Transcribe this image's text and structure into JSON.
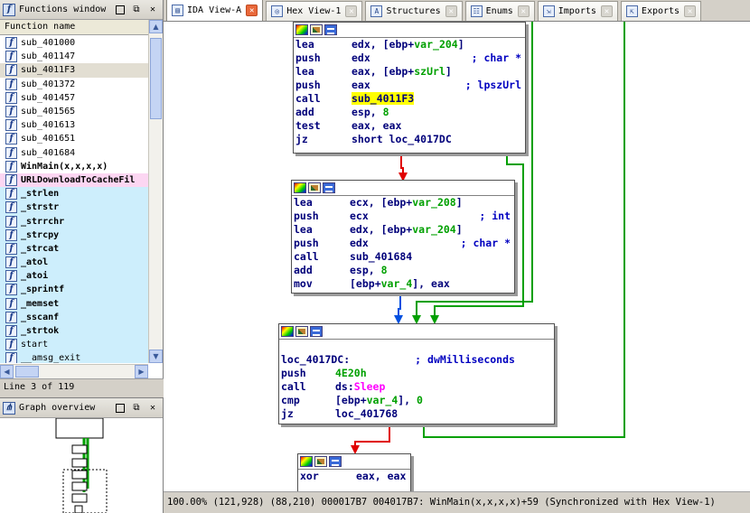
{
  "functions_window": {
    "title": "Functions window",
    "column_header": "Function name",
    "items": [
      {
        "name": "sub_401000",
        "kind": "normal"
      },
      {
        "name": "sub_401147",
        "kind": "normal"
      },
      {
        "name": "sub_4011F3",
        "kind": "selected"
      },
      {
        "name": "sub_401372",
        "kind": "normal"
      },
      {
        "name": "sub_401457",
        "kind": "normal"
      },
      {
        "name": "sub_401565",
        "kind": "normal"
      },
      {
        "name": "sub_401613",
        "kind": "normal"
      },
      {
        "name": "sub_401651",
        "kind": "normal"
      },
      {
        "name": "sub_401684",
        "kind": "normal"
      },
      {
        "name": "WinMain(x,x,x,x)",
        "kind": "bold"
      },
      {
        "name": "URLDownloadToCacheFil",
        "kind": "import"
      },
      {
        "name": "_strlen",
        "kind": "lib"
      },
      {
        "name": "_strstr",
        "kind": "lib"
      },
      {
        "name": "_strrchr",
        "kind": "lib"
      },
      {
        "name": "_strcpy",
        "kind": "lib"
      },
      {
        "name": "_strcat",
        "kind": "lib"
      },
      {
        "name": "_atol",
        "kind": "lib"
      },
      {
        "name": "_atoi",
        "kind": "lib"
      },
      {
        "name": "_sprintf",
        "kind": "lib"
      },
      {
        "name": "_memset",
        "kind": "lib"
      },
      {
        "name": "_sscanf",
        "kind": "lib"
      },
      {
        "name": "_strtok",
        "kind": "lib"
      },
      {
        "name": "start",
        "kind": "lib-plain"
      },
      {
        "name": "__amsg_exit",
        "kind": "lib-plain"
      }
    ],
    "status": "Line 3 of 119"
  },
  "graph_overview": {
    "title": "Graph overview"
  },
  "tabs": [
    {
      "label": "IDA View-A",
      "active": true,
      "icon": "ida-view-icon"
    },
    {
      "label": "Hex View-1",
      "active": false,
      "icon": "hex-view-icon"
    },
    {
      "label": "Structures",
      "active": false,
      "icon": "structures-icon"
    },
    {
      "label": "Enums",
      "active": false,
      "icon": "enums-icon"
    },
    {
      "label": "Imports",
      "active": false,
      "icon": "imports-icon"
    },
    {
      "label": "Exports",
      "active": false,
      "icon": "exports-icon"
    }
  ],
  "nodes": {
    "block1": {
      "lines": [
        {
          "mn": "lea",
          "ops": "edx, [ebp+",
          "var": "var_204",
          "tail": "]",
          "cmt": ""
        },
        {
          "mn": "push",
          "ops": "edx",
          "var": "",
          "tail": "",
          "cmt": "; char *"
        },
        {
          "mn": "lea",
          "ops": "eax, [ebp+",
          "var": "szUrl",
          "tail": "]",
          "cmt": ""
        },
        {
          "mn": "push",
          "ops": "eax",
          "var": "",
          "tail": "",
          "cmt": "; lpszUrl"
        },
        {
          "mn": "call",
          "ops": "",
          "hl": "sub_4011F3",
          "var": "",
          "tail": "",
          "cmt": ""
        },
        {
          "mn": "add",
          "ops": "esp, ",
          "num": "8",
          "var": "",
          "tail": "",
          "cmt": ""
        },
        {
          "mn": "test",
          "ops": "eax, eax",
          "var": "",
          "tail": "",
          "cmt": ""
        },
        {
          "mn": "jz",
          "ops": "short loc_4017DC",
          "var": "",
          "tail": "",
          "cmt": ""
        }
      ]
    },
    "block2": {
      "lines": [
        {
          "mn": "lea",
          "ops": "ecx, [ebp+",
          "var": "var_208",
          "tail": "]",
          "cmt": ""
        },
        {
          "mn": "push",
          "ops": "ecx",
          "var": "",
          "tail": "",
          "cmt": "; int"
        },
        {
          "mn": "lea",
          "ops": "edx, [ebp+",
          "var": "var_204",
          "tail": "]",
          "cmt": ""
        },
        {
          "mn": "push",
          "ops": "edx",
          "var": "",
          "tail": "",
          "cmt": "; char *"
        },
        {
          "mn": "call",
          "ops": "sub_401684",
          "var": "",
          "tail": "",
          "cmt": ""
        },
        {
          "mn": "add",
          "ops": "esp, ",
          "num": "8",
          "var": "",
          "tail": "",
          "cmt": ""
        },
        {
          "mn": "mov",
          "ops": "[ebp+",
          "var": "var_4",
          "tail": "], eax",
          "cmt": ""
        }
      ]
    },
    "block3": {
      "label": "loc_4017DC:",
      "label_cmt": "; dwMilliseconds",
      "lines": [
        {
          "mn": "push",
          "ops": "",
          "num": "4E20h",
          "var": "",
          "tail": "",
          "cmt": ""
        },
        {
          "mn": "call",
          "ops": "ds:",
          "imp": "Sleep",
          "var": "",
          "tail": "",
          "cmt": ""
        },
        {
          "mn": "cmp",
          "ops": "[ebp+",
          "var": "var_4",
          "tail": "], ",
          "num2": "0",
          "cmt": ""
        },
        {
          "mn": "jz",
          "ops": "loc_401768",
          "var": "",
          "tail": "",
          "cmt": ""
        }
      ]
    },
    "block4": {
      "lines": [
        {
          "mn": "xor",
          "ops": "eax, eax",
          "var": "",
          "tail": "",
          "cmt": ""
        }
      ]
    }
  },
  "colors": {
    "edge_true": "#00a000",
    "edge_false": "#e00000",
    "edge_uncond": "#0050e0",
    "highlight": "#ffff00",
    "lib_bg": "#cdeefc",
    "import_bg": "#fcd6f2"
  },
  "status_bar": {
    "text": "100.00% (121,928) (88,210) 000017B7 004017B7: WinMain(x,x,x,x)+59 (Synchronized with Hex View-1)"
  }
}
